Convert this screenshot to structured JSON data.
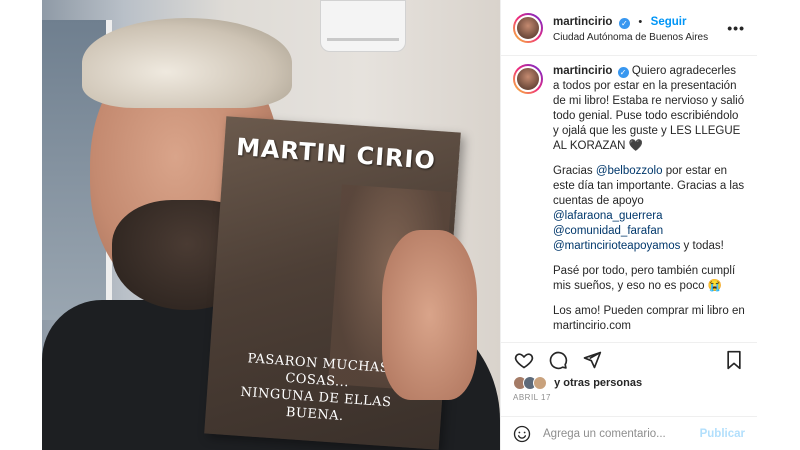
{
  "post": {
    "author": "martincirio",
    "follow_label": "Seguir",
    "location": "Ciudad Autónoma de Buenos Aires",
    "more_label": "•••",
    "separator": "•"
  },
  "photo": {
    "book_title": "MARTIN CIRIO",
    "book_subtitle_line1": "PASARON MUCHAS COSAS...",
    "book_subtitle_line2": "NINGUNA DE ELLAS BUENA."
  },
  "caption": {
    "author": "martincirio",
    "p1": "Quiero agradecerles a todos por estar en la presentación de mi libro! Estaba re nervioso y salió todo genial. Puse todo escribiéndolo y ojalá que les guste y LES LLEGUE AL KORAZAN 🖤",
    "p2_pre": "Gracias ",
    "p2_mention1": "@belbozzolo",
    "p2_mid": " por estar en este día tan importante. Gracias a las cuentas de apoyo ",
    "p2_mention2": "@lafaraona_guerrera",
    "p2_mention3": "@comunidad_farafan",
    "p2_mention4": "@martincirioteapoyamos",
    "p2_post": " y todas!",
    "p3": "Pasé por todo, pero también cumplí mis sueños, y eso no es poco 😭",
    "p4": "Los amo! Pueden comprar mi libro en martincirio.com"
  },
  "likes_text": "y otras personas",
  "date": "ABRIL 17",
  "comment": {
    "placeholder": "Agrega un comentario...",
    "publish_label": "Publicar"
  },
  "icons": [
    "heart-icon",
    "comment-icon",
    "share-icon",
    "bookmark-icon",
    "emoji-icon",
    "verified-icon"
  ],
  "colors": {
    "link": "#0095f6",
    "mention": "#00376b",
    "verified": "#3897f0",
    "muted": "#8e8e8e"
  }
}
